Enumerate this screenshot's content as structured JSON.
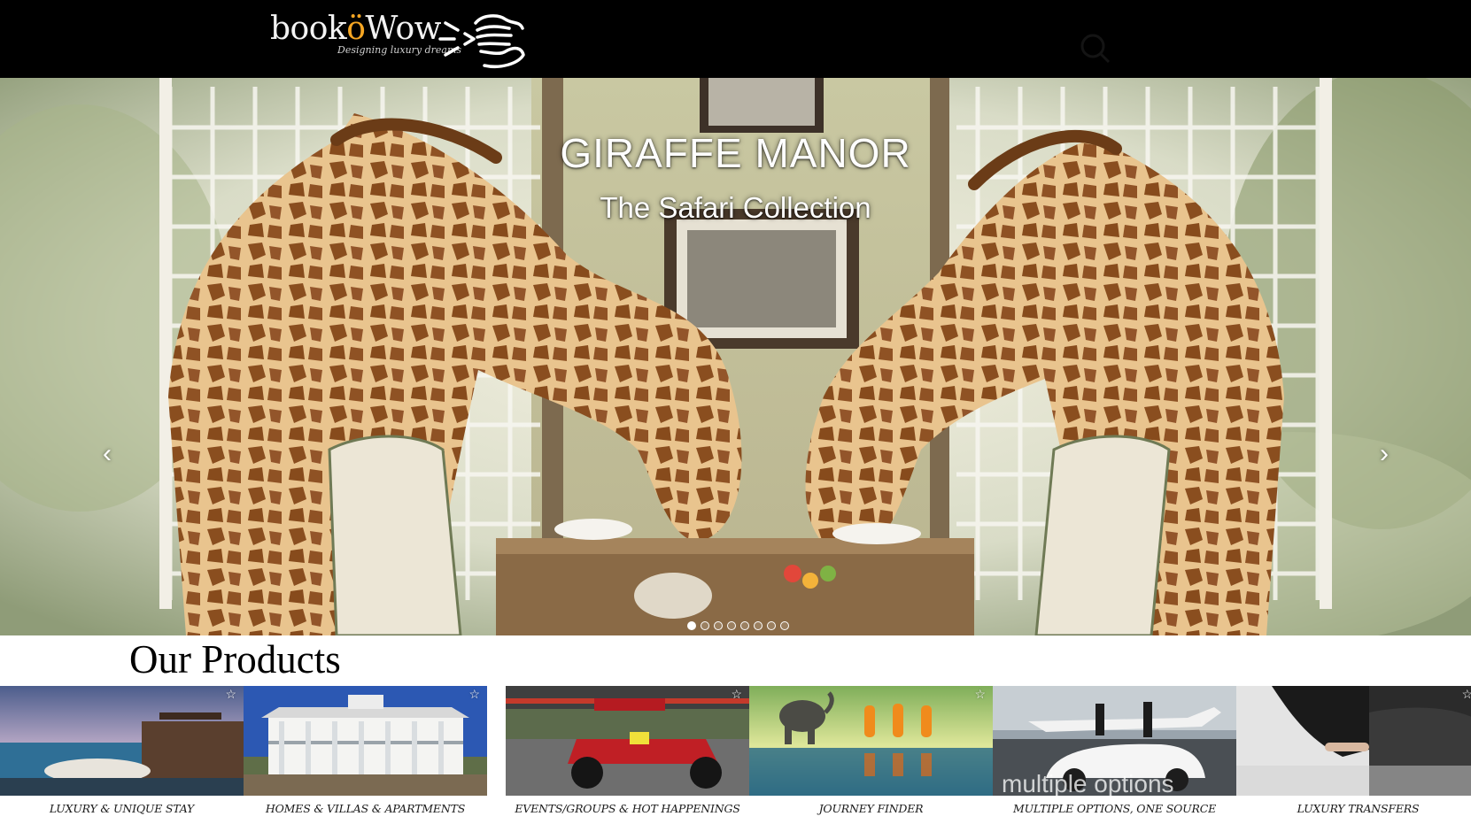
{
  "header": {
    "logo_text_main": "booköWow",
    "logo_text_pre": "book",
    "logo_text_accent": "ö",
    "logo_text_post": "Wow",
    "logo_tagline": "Designing luxury dreams",
    "logo_icon": "pointing-hand-icon",
    "search_icon": "search-icon",
    "background": "#000000"
  },
  "hero": {
    "title": "GIRAFFE MANOR",
    "subtitle": "The Safari Collection",
    "prev_icon": "chevron-left-icon",
    "next_icon": "chevron-right-icon",
    "prev_glyph": "‹",
    "next_glyph": "›",
    "slide_count": 8,
    "active_slide": 1
  },
  "products": {
    "heading": "Our Products",
    "items": [
      {
        "label": "LUXURY & UNIQUE STAY",
        "image": "overwater-villa-sunset",
        "star": "☆"
      },
      {
        "label": "HOMES & VILLAS & APARTMENTS",
        "image": "white-colonial-mansion",
        "star": "☆"
      },
      {
        "label": "EVENTS/GROUPS & HOT HAPPENINGS",
        "image": "formula-race-car",
        "star": "☆"
      },
      {
        "label": "JOURNEY FINDER",
        "image": "elephant-and-monks",
        "star": "☆",
        "overlay": ""
      },
      {
        "label": "MULTIPLE OPTIONS, ONE SOURCE",
        "image": "private-jet-sportscar",
        "star": "",
        "overlay": "multiple options"
      },
      {
        "label": "LUXURY TRANSFERS",
        "image": "chauffeur-car-door",
        "star": "☆"
      }
    ]
  },
  "colors": {
    "logo_accent": "#f5a623",
    "header_bg": "#000000",
    "page_bg": "#ffffff"
  }
}
